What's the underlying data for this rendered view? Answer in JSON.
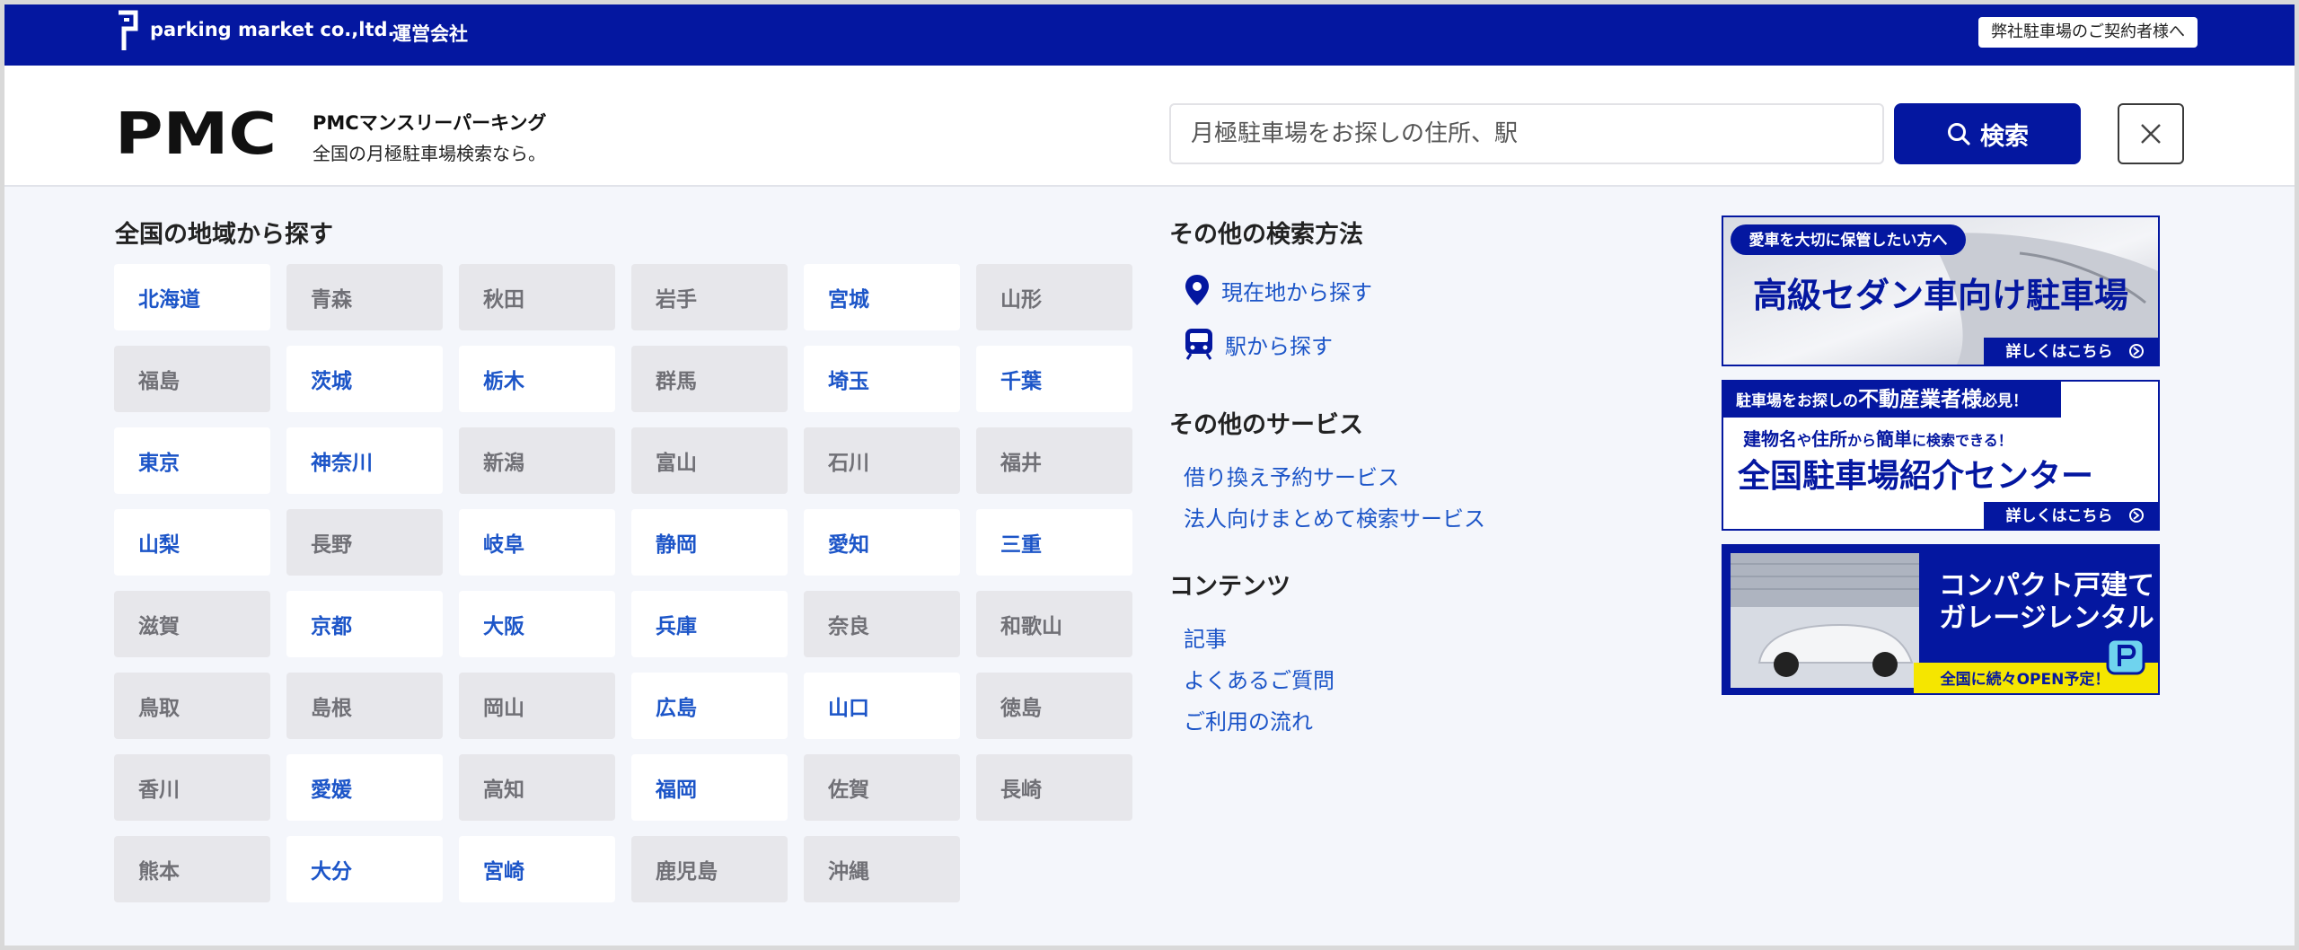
{
  "topbar": {
    "company": "parking market co.,ltd.",
    "operator": "運営会社",
    "contract_label": "弊社駐車場のご契約者様へ"
  },
  "header": {
    "brand_logo_text": "PMC",
    "brand_title": "PMCマンスリーパーキング",
    "brand_subtitle": "全国の月極駐車場検索なら。",
    "search_placeholder": "月極駐車場をお探しの住所、駅",
    "search_button": "検索"
  },
  "regions": {
    "title": "全国の地域から探す",
    "prefectures": [
      {
        "name": "北海道",
        "active": true
      },
      {
        "name": "青森",
        "active": false
      },
      {
        "name": "秋田",
        "active": false
      },
      {
        "name": "岩手",
        "active": false
      },
      {
        "name": "宮城",
        "active": true
      },
      {
        "name": "山形",
        "active": false
      },
      {
        "name": "福島",
        "active": false
      },
      {
        "name": "茨城",
        "active": true
      },
      {
        "name": "栃木",
        "active": true
      },
      {
        "name": "群馬",
        "active": false
      },
      {
        "name": "埼玉",
        "active": true
      },
      {
        "name": "千葉",
        "active": true
      },
      {
        "name": "東京",
        "active": true
      },
      {
        "name": "神奈川",
        "active": true
      },
      {
        "name": "新潟",
        "active": false
      },
      {
        "name": "富山",
        "active": false
      },
      {
        "name": "石川",
        "active": false
      },
      {
        "name": "福井",
        "active": false
      },
      {
        "name": "山梨",
        "active": true
      },
      {
        "name": "長野",
        "active": false
      },
      {
        "name": "岐阜",
        "active": true
      },
      {
        "name": "静岡",
        "active": true
      },
      {
        "name": "愛知",
        "active": true
      },
      {
        "name": "三重",
        "active": true
      },
      {
        "name": "滋賀",
        "active": false
      },
      {
        "name": "京都",
        "active": true
      },
      {
        "name": "大阪",
        "active": true
      },
      {
        "name": "兵庫",
        "active": true
      },
      {
        "name": "奈良",
        "active": false
      },
      {
        "name": "和歌山",
        "active": false
      },
      {
        "name": "鳥取",
        "active": false
      },
      {
        "name": "島根",
        "active": false
      },
      {
        "name": "岡山",
        "active": false
      },
      {
        "name": "広島",
        "active": true
      },
      {
        "name": "山口",
        "active": true
      },
      {
        "name": "徳島",
        "active": false
      },
      {
        "name": "香川",
        "active": false
      },
      {
        "name": "愛媛",
        "active": true
      },
      {
        "name": "高知",
        "active": false
      },
      {
        "name": "福岡",
        "active": true
      },
      {
        "name": "佐賀",
        "active": false
      },
      {
        "name": "長崎",
        "active": false
      },
      {
        "name": "熊本",
        "active": false
      },
      {
        "name": "大分",
        "active": true
      },
      {
        "name": "宮崎",
        "active": true
      },
      {
        "name": "鹿児島",
        "active": false
      },
      {
        "name": "沖縄",
        "active": false
      }
    ]
  },
  "other_methods": {
    "title": "その他の検索方法",
    "current_location": "現在地から探す",
    "station": "駅から探す"
  },
  "other_services": {
    "title": "その他のサービス",
    "items": [
      "借り換え予約サービス",
      "法人向けまとめて検索サービス"
    ]
  },
  "contents": {
    "title": "コンテンツ",
    "items": [
      "記事",
      "よくあるご質問",
      "ご利用の流れ"
    ]
  },
  "banners": {
    "sedan": {
      "tag": "愛車を大切に保管したい方へ",
      "headline": "高級セダン車向け駐車場",
      "more": "詳しくはこちら"
    },
    "realestate": {
      "tag_prefix": "駐車場をお探しの",
      "tag_emph": "不動産業者様",
      "tag_suffix": "必見！",
      "sub_1": "建物名",
      "sub_2": "や",
      "sub_3": "住所",
      "sub_4": "から",
      "sub_5": "簡単",
      "sub_6": "に検索できる！",
      "headline": "全国駐車場紹介センター",
      "more": "詳しくはこちら"
    },
    "garage": {
      "line1": "コンパクト戸建て",
      "line2": "ガレージレンタル",
      "footer": "全国に続々OPEN予定！"
    }
  },
  "colors": {
    "brand_navy": "#0417a0",
    "link_blue": "#1c55c8",
    "active_tile": "#ffffff",
    "inactive_tile": "#e7e7eb",
    "banner_yellow": "#f5e600"
  }
}
